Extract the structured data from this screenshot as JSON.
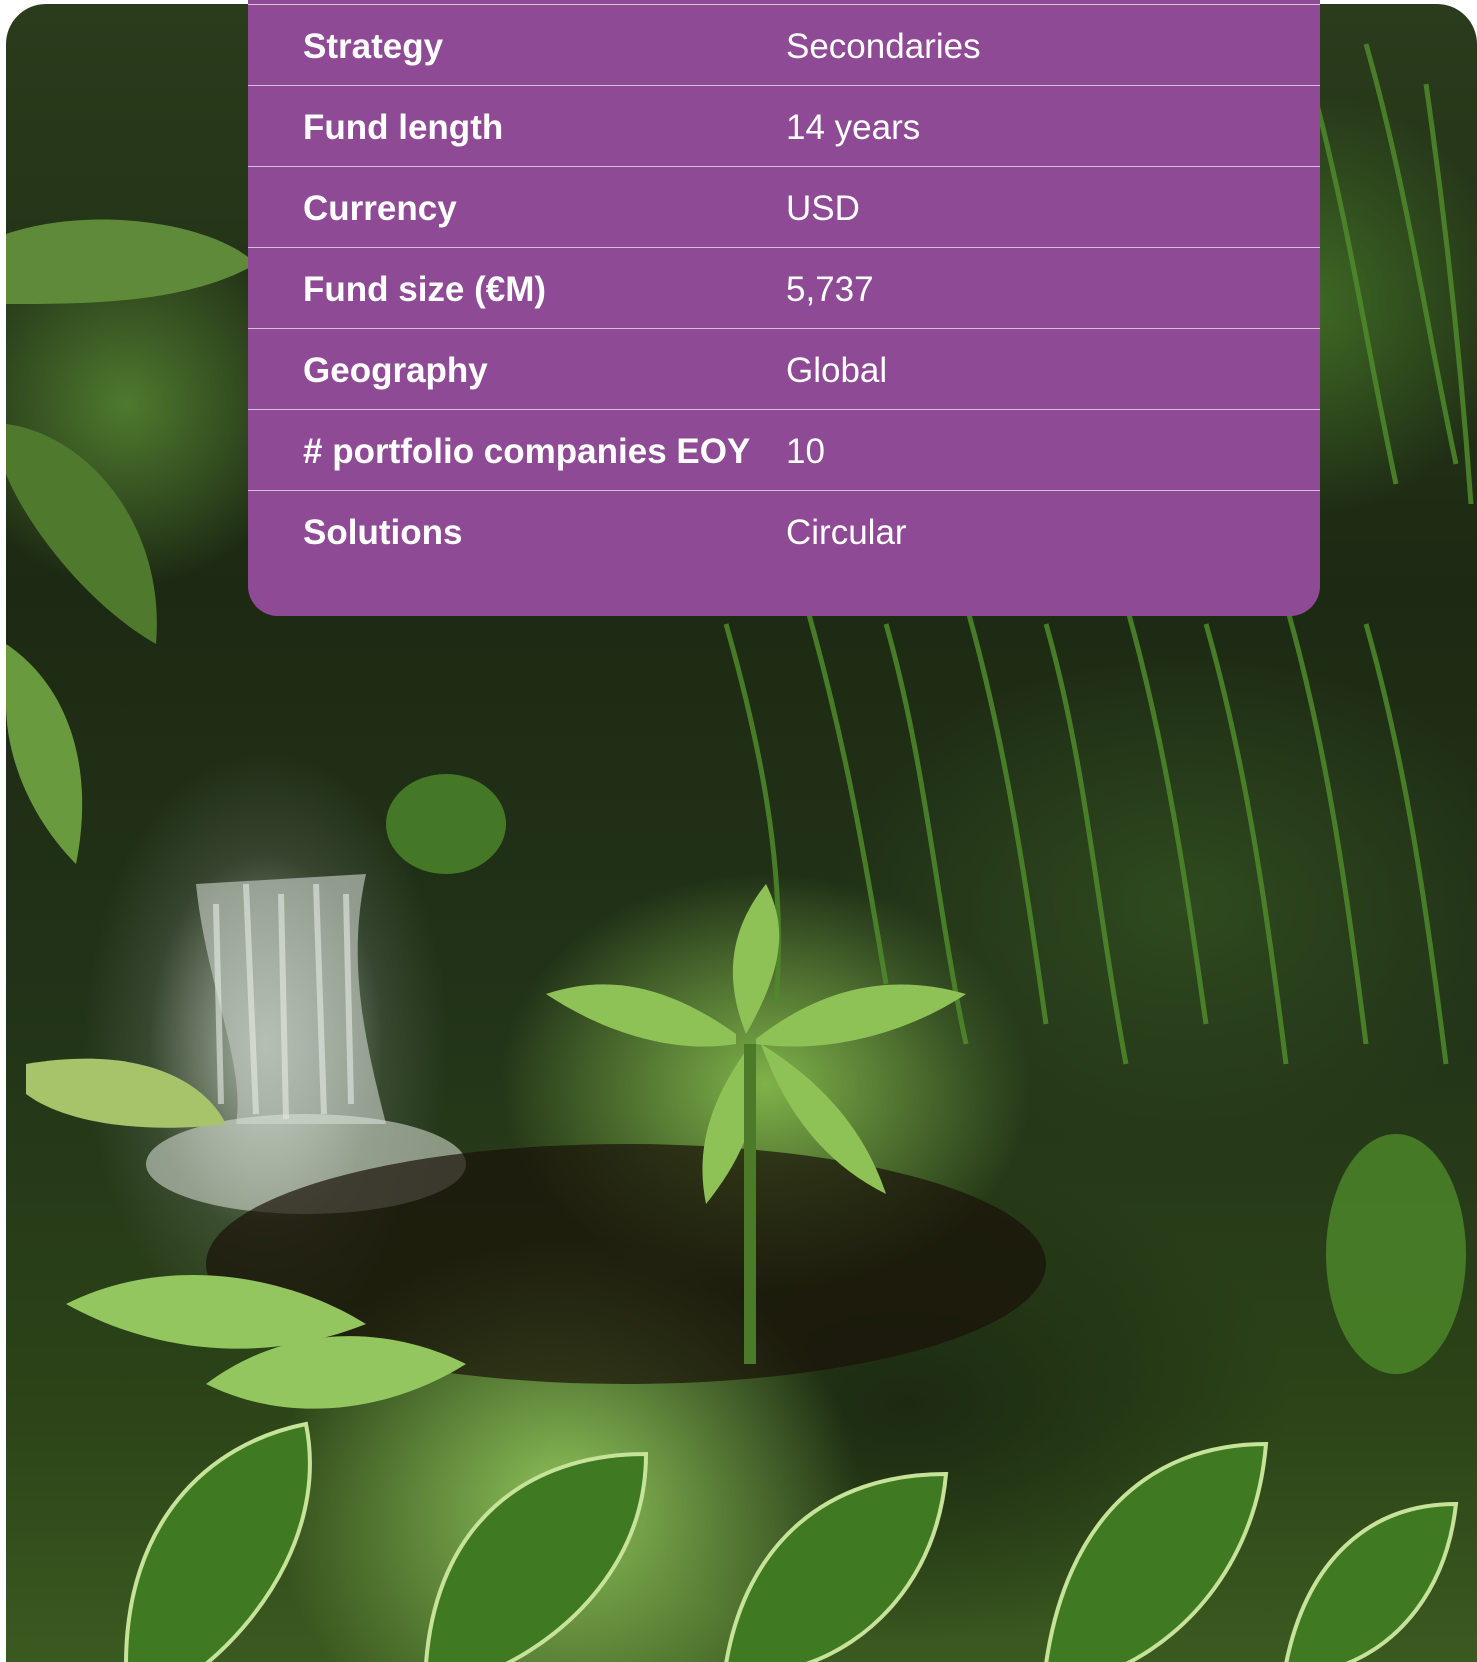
{
  "fund_table": {
    "rows": [
      {
        "label": "Strategy",
        "value": "Secondaries"
      },
      {
        "label": "Fund length",
        "value": "14 years"
      },
      {
        "label": "Currency",
        "value": "USD"
      },
      {
        "label": "Fund size (€M)",
        "value": "5,737"
      },
      {
        "label": "Geography",
        "value": "Global"
      },
      {
        "label": "# portfolio companies EOY",
        "value": "10"
      },
      {
        "label": "Solutions",
        "value": "Circular"
      }
    ]
  },
  "colors": {
    "card_background": "#8e4a94",
    "text": "#ffffff"
  },
  "background_image": "tropical-garden-waterfall-photo"
}
